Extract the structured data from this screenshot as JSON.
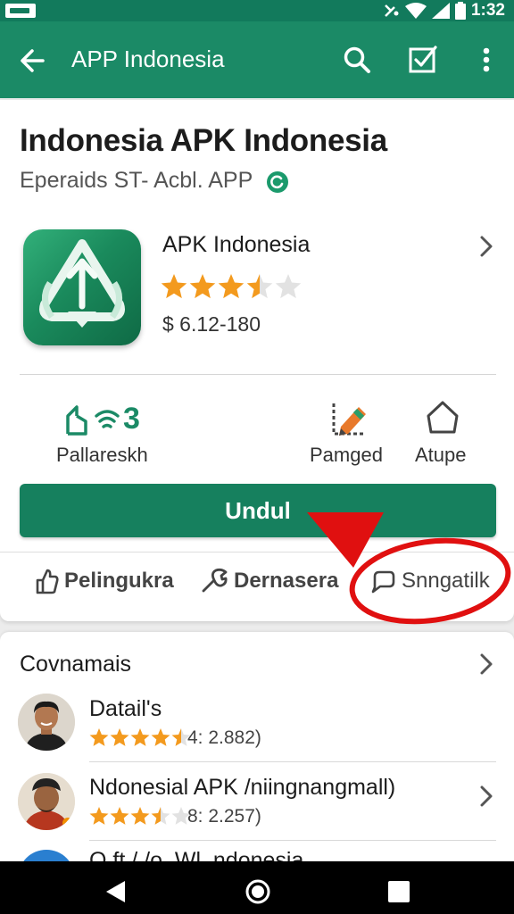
{
  "status_bar": {
    "time": "1:32"
  },
  "app_bar": {
    "title": "APP Indonesia"
  },
  "app": {
    "page_title": "Indonesia APK Indonesia",
    "subtitle": "Eperaids ST- Acbl. APP",
    "name": "APK Indonesia",
    "rating": 3.5,
    "price": "$ 6.12-180"
  },
  "stats": {
    "first_value": "3",
    "first_label": "Pallareskh",
    "second_label": "Pamged",
    "third_label": "Atupe"
  },
  "install_button": {
    "label": "Undul"
  },
  "actions": [
    {
      "label": "Pelingukra"
    },
    {
      "label": "Dernasera"
    },
    {
      "label": "Snngatilk"
    }
  ],
  "reviews": {
    "title": "Covnamais",
    "items": [
      {
        "name": "Datail's",
        "rating": 4.5,
        "count": "4: 2.882)"
      },
      {
        "name": "Ndonesial APK /niingnangmall)",
        "rating": 3.5,
        "count": "8: 2.257)"
      },
      {
        "name": "O ft / /o..Wl..ndonesia",
        "rating": null,
        "count": ""
      }
    ]
  },
  "colors": {
    "primary": "#1b8a66",
    "primary_dark": "#127a5c",
    "button": "#16805e",
    "star": "#f39a1e",
    "annotation": "#e01010"
  }
}
